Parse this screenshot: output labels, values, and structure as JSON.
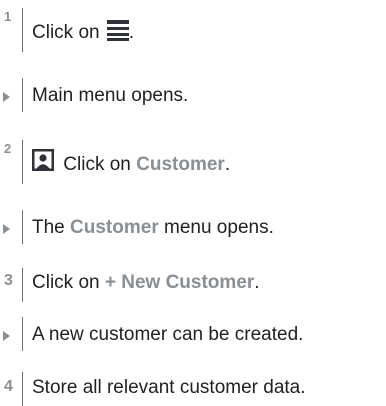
{
  "steps": [
    {
      "number": "1",
      "text_before": "Click on",
      "text_after": "."
    },
    {
      "result": "Main menu opens."
    },
    {
      "number": "2",
      "text_before": "Click on",
      "link": "Customer",
      "text_after": "."
    },
    {
      "result_before": "The",
      "result_link": "Customer",
      "result_after": "menu opens."
    },
    {
      "number": "3",
      "text_before": "Click on",
      "link": "+ New Customer",
      "text_after": "."
    },
    {
      "result": "A new customer can be created."
    },
    {
      "number": "4",
      "text_before": "Store all relevant customer data."
    }
  ],
  "icons": {
    "menu": "hamburger-menu-icon",
    "customer": "user-icon",
    "arrow": "triangle-right-icon"
  },
  "colors": {
    "text": "#222222",
    "highlight": "#8a8f94",
    "icon": "#2f3337"
  }
}
